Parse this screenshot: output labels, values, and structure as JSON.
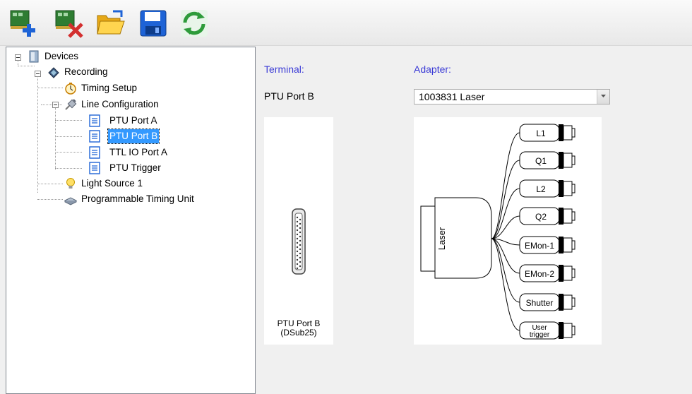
{
  "toolbar": {
    "buttons": [
      {
        "name": "add-device-button",
        "icon": "add-device-icon"
      },
      {
        "name": "remove-device-button",
        "icon": "remove-device-icon"
      },
      {
        "name": "open-button",
        "icon": "open-folder-icon"
      },
      {
        "name": "save-button",
        "icon": "save-icon"
      },
      {
        "name": "refresh-button",
        "icon": "refresh-icon"
      }
    ]
  },
  "tree": {
    "root": "Devices",
    "recording": "Recording",
    "timing_setup": "Timing Setup",
    "line_configuration": "Line Configuration",
    "ports": [
      "PTU Port A",
      "PTU Port B",
      "TTL IO Port A",
      "PTU Trigger"
    ],
    "selected_port_index": 1,
    "light_source": "Light Source 1",
    "ptu": "Programmable Timing Unit"
  },
  "detail": {
    "terminal_label": "Terminal:",
    "adapter_label": "Adapter:",
    "terminal_value": "PTU Port B",
    "adapter_selected": "1003831 Laser",
    "terminal_caption_line1": "PTU Port B",
    "terminal_caption_line2": "(DSub25)",
    "adapter_body_label": "Laser",
    "adapter_connectors": [
      "L1",
      "Q1",
      "L2",
      "Q2",
      "EMon-1",
      "EMon-2",
      "Shutter"
    ],
    "adapter_last_line1": "User",
    "adapter_last_line2": "trigger"
  },
  "colors": {
    "accent_label": "#3b3bd6",
    "selection": "#3399ff"
  }
}
